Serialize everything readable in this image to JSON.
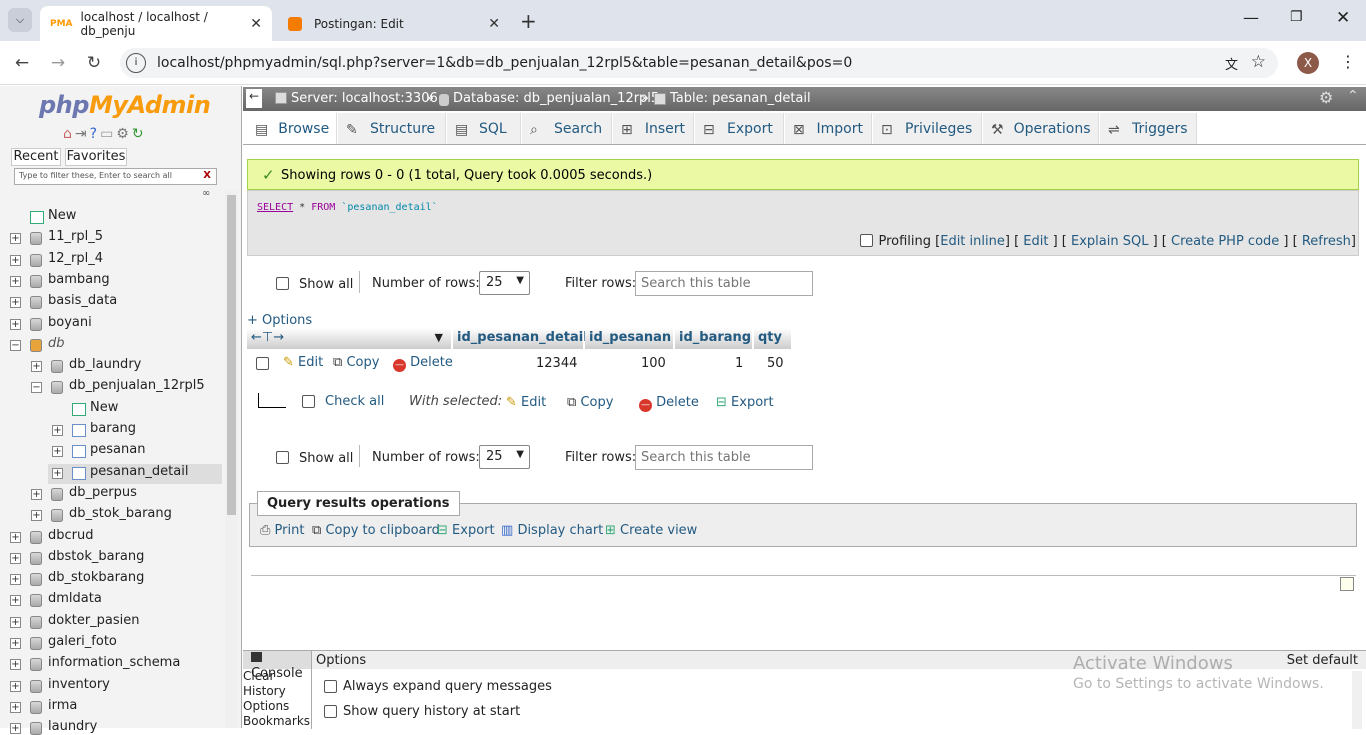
{
  "browser": {
    "tabs": [
      {
        "label": "localhost / localhost / db_penju",
        "active": true
      },
      {
        "label": "Postingan: Edit",
        "active": false
      }
    ],
    "url": "localhost/phpmyadmin/sql.php?server=1&db=db_penjualan_12rpl5&table=pesanan_detail&pos=0",
    "profile_initial": "X"
  },
  "sidebar": {
    "logo_php": "php",
    "logo_myadmin": "MyAdmin",
    "recent": "Recent",
    "favorites": "Favorites",
    "filter_placeholder": "Type to filter these, Enter to search all",
    "filter_clear": "X",
    "new": "New",
    "databases": [
      "11_rpl_5",
      "12_rpl_4",
      "bambang",
      "basis_data",
      "boyani",
      "db"
    ],
    "db_children": [
      "db_laundry",
      "db_penjualan_12rpl5"
    ],
    "db_penj_children": [
      "New",
      "barang",
      "pesanan",
      "pesanan_detail"
    ],
    "db_after": [
      "db_perpus",
      "db_stok_barang"
    ],
    "databases_after": [
      "dbcrud",
      "dbstok_barang",
      "db_stokbarang",
      "dmldata",
      "dokter_pasien",
      "galeri_foto",
      "information_schema",
      "inventory",
      "irma",
      "laundry"
    ]
  },
  "breadcrumb": {
    "server": "Server: localhost:3306",
    "database": "Database: db_penjualan_12rpl5",
    "table": "Table: pesanan_detail",
    "sep": "»"
  },
  "tabs": [
    "Browse",
    "Structure",
    "SQL",
    "Search",
    "Insert",
    "Export",
    "Import",
    "Privileges",
    "Operations",
    "Triggers"
  ],
  "message": "Showing rows 0 - 0 (1 total, Query took 0.0005 seconds.)",
  "sql": {
    "kw1": "SELECT",
    "star": "*",
    "kw2": "FROM",
    "table": "`pesanan_detail`"
  },
  "profiling": {
    "label": "Profiling",
    "links": [
      "Edit inline",
      "Edit",
      "Explain SQL",
      "Create PHP code",
      "Refresh"
    ]
  },
  "nav": {
    "show_all": "Show all",
    "num_rows_label": "Number of rows:",
    "num_rows_value": "25",
    "filter_label": "Filter rows:",
    "filter_placeholder": "Search this table"
  },
  "options_link": "+ Options",
  "columns": [
    "id_pesanan_detail",
    "id_pesanan",
    "id_barang",
    "qty"
  ],
  "rows": [
    {
      "actions": [
        "Edit",
        "Copy",
        "Delete"
      ],
      "values": [
        "12344",
        "100",
        "1",
        "50"
      ]
    }
  ],
  "bulk": {
    "check_all": "Check all",
    "with_selected": "With selected:",
    "actions": [
      "Edit",
      "Copy",
      "Delete",
      "Export"
    ]
  },
  "query_ops": {
    "title": "Query results operations",
    "actions": [
      "Print",
      "Copy to clipboard",
      "Export",
      "Display chart",
      "Create view"
    ]
  },
  "console": {
    "title": "Console",
    "links": [
      "Clear",
      "History",
      "Options",
      "Bookmarks"
    ],
    "options_title": "Options",
    "set_default": "Set default",
    "opt1": "Always expand query messages",
    "opt2": "Show query history at start"
  },
  "watermark": {
    "line1": "Activate Windows",
    "line2": "Go to Settings to activate Windows."
  },
  "colors": {
    "link": "#235a81",
    "success_bg": "#ebf8a4",
    "breadcrumb_bg": "#777777",
    "delete": "#d9362c"
  }
}
